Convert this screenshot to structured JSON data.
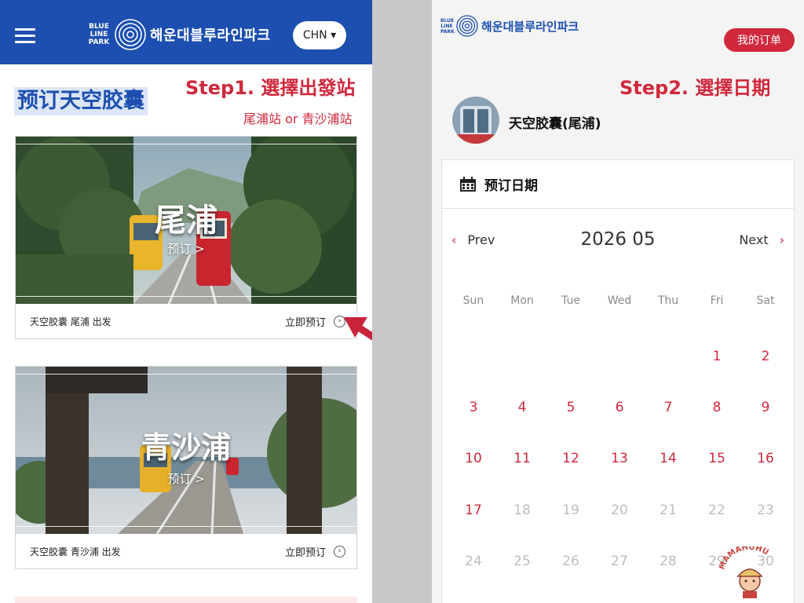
{
  "left": {
    "header": {
      "logo_mini": "BLUE LINE PARK",
      "logo_text": "해운대블루라인파크",
      "lang": "CHN ▾"
    },
    "title": "预订天空胶囊",
    "step1": "Step1. 選擇出發站",
    "step1_sub": "尾浦站 or 青沙浦站",
    "cards": [
      {
        "photo_title": "尾浦",
        "photo_sub": "预订 >",
        "caption": "天空胶囊 尾浦 出发",
        "action": "立即预订"
      },
      {
        "photo_title": "青沙浦",
        "photo_sub": "预订 >",
        "caption": "天空胶囊 青沙浦 出发",
        "action": "立即预订"
      }
    ]
  },
  "right": {
    "logo_mini": "BLUE LINE PARK",
    "logo_text": "해운대블루라인파크",
    "orders": "我的订单",
    "step2": "Step2. 選擇日期",
    "product": "天空胶囊(尾浦)",
    "calendar": {
      "header": "预订日期",
      "prev": "Prev",
      "next": "Next",
      "month": "2026 05",
      "weekdays": [
        "Sun",
        "Mon",
        "Tue",
        "Wed",
        "Thu",
        "Fri",
        "Sat"
      ],
      "first_weekday_index": 5,
      "days": [
        {
          "d": "1",
          "on": true
        },
        {
          "d": "2",
          "on": true
        },
        {
          "d": "3",
          "on": true
        },
        {
          "d": "4",
          "on": true
        },
        {
          "d": "5",
          "on": true
        },
        {
          "d": "6",
          "on": true
        },
        {
          "d": "7",
          "on": true
        },
        {
          "d": "8",
          "on": true
        },
        {
          "d": "9",
          "on": true
        },
        {
          "d": "10",
          "on": true
        },
        {
          "d": "11",
          "on": true
        },
        {
          "d": "12",
          "on": true
        },
        {
          "d": "13",
          "on": true
        },
        {
          "d": "14",
          "on": true
        },
        {
          "d": "15",
          "on": true
        },
        {
          "d": "16",
          "on": true
        },
        {
          "d": "17",
          "on": true
        },
        {
          "d": "18",
          "on": false
        },
        {
          "d": "19",
          "on": false
        },
        {
          "d": "20",
          "on": false
        },
        {
          "d": "21",
          "on": false
        },
        {
          "d": "22",
          "on": false
        },
        {
          "d": "23",
          "on": false
        },
        {
          "d": "24",
          "on": false
        },
        {
          "d": "25",
          "on": false
        },
        {
          "d": "26",
          "on": false
        },
        {
          "d": "27",
          "on": false
        },
        {
          "d": "28",
          "on": false
        },
        {
          "d": "29",
          "on": false
        },
        {
          "d": "30",
          "on": false
        }
      ]
    }
  },
  "watermark": "MAMAHUHU",
  "colors": {
    "brand_blue": "#1c4fb0",
    "accent_red": "#d0283c"
  }
}
